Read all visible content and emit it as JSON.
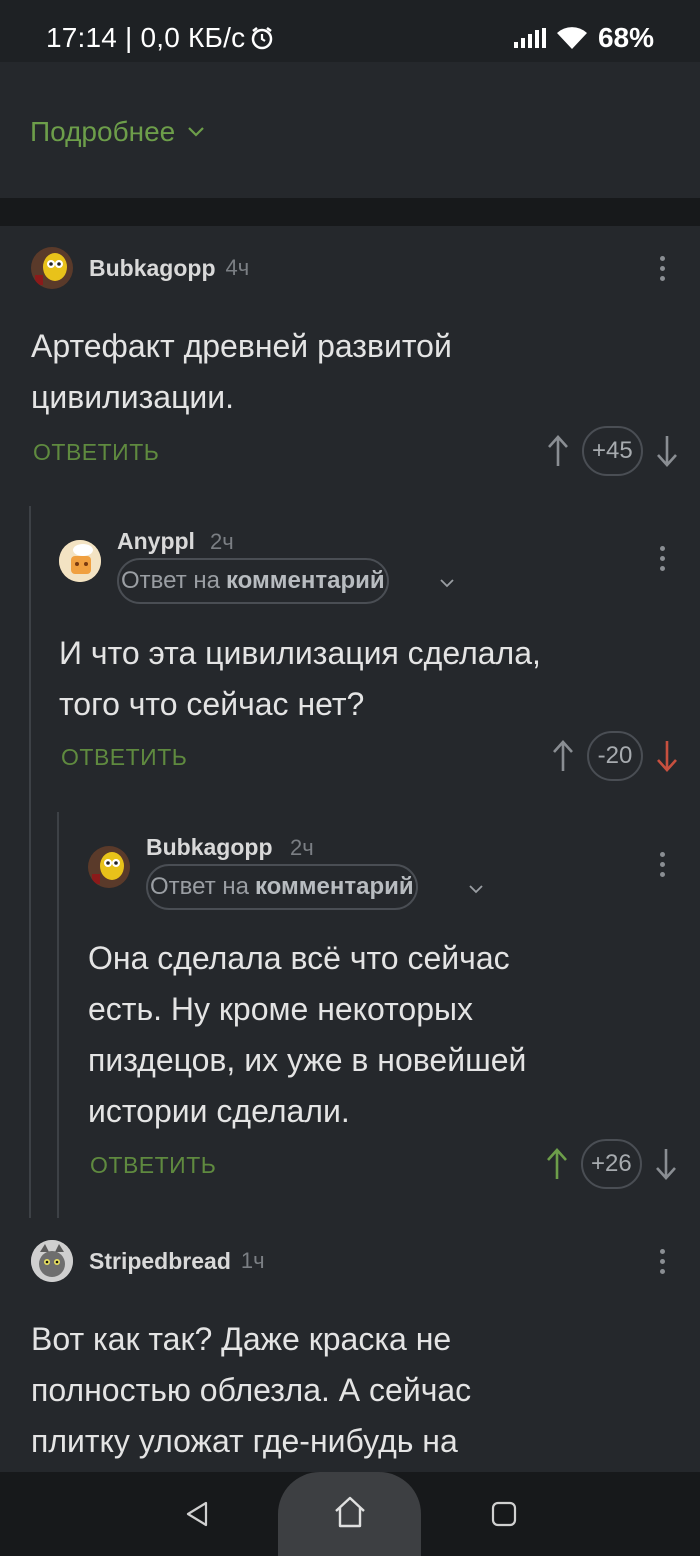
{
  "status_bar": {
    "time_speed": "17:14 | 0,0 КБ/с",
    "battery": "68%"
  },
  "top_panel": {
    "more_label": "Подробнее"
  },
  "comments": [
    {
      "author": "Bubkagopp",
      "time": "4ч",
      "reply_to": null,
      "text_lines": [
        "Артефакт древней развитой",
        "цивилизации."
      ],
      "reply_label": "ОТВЕТИТЬ",
      "score": "+45",
      "vote_state": "none"
    },
    {
      "author": "Anyppl",
      "time": "2ч",
      "reply_to_prefix": "Ответ на",
      "reply_to_target": "комментарий",
      "text_lines": [
        "И что эта цивилизация сделала,",
        "того что сейчас нет?"
      ],
      "reply_label": "ОТВЕТИТЬ",
      "score": "-20",
      "vote_state": "down"
    },
    {
      "author": "Bubkagopp",
      "time": "2ч",
      "reply_to_prefix": "Ответ на",
      "reply_to_target": "комментарий",
      "text_lines": [
        "Она сделала всё что сейчас",
        "есть. Ну кроме некоторых",
        "пиздецов, их уже в новейшей",
        "истории сделали."
      ],
      "reply_label": "ОТВЕТИТЬ",
      "score": "+26",
      "vote_state": "up"
    },
    {
      "author": "Stripedbread",
      "time": "1ч",
      "text_lines": [
        "Вот как так? Даже краска не",
        "полностью облезла. А сейчас",
        "плитку уложат где-нибудь на"
      ]
    }
  ],
  "colors": {
    "accent_green": "#6d9e4a",
    "downvote_red": "#c7503f",
    "background": "#25282c"
  }
}
